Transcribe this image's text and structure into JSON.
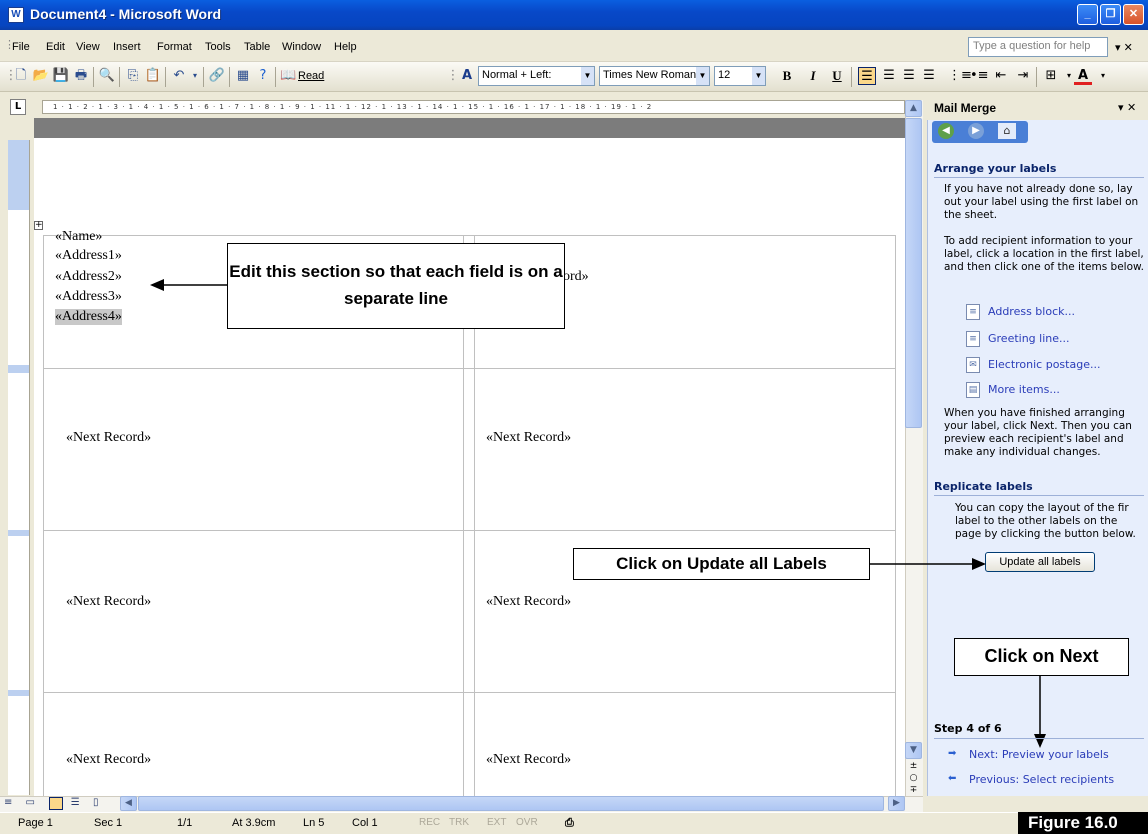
{
  "window": {
    "title": "Document4 - Microsoft Word"
  },
  "menu": {
    "items": [
      "File",
      "Edit",
      "View",
      "Insert",
      "Format",
      "Tools",
      "Table",
      "Window",
      "Help"
    ],
    "help_placeholder": "Type a question for help"
  },
  "toolbar": {
    "read_label": "Read",
    "style": "Normal + Left:",
    "font": "Times New Roman",
    "size": "12",
    "bold": "B",
    "italic": "I",
    "underline": "U"
  },
  "ruler": {
    "ticks": "1 · 1 · 2 · 1 · 3 · 1 · 4 · 1 · 5 · 1 · 6 · 1 · 7 · 1 · 8 · 1 · 9 ·      1 · 11 · 1 · 12 · 1 · 13 · 1 · 14 · 1 · 15 · 1 · 16 · 1 · 17 · 1 · 18 · 1 · 19 · 1 · 2"
  },
  "document": {
    "first_label_fields": [
      "«Name»",
      "«Address1»",
      "«Address2»",
      "«Address3»",
      "«Address4»"
    ],
    "partial_text": "ord»",
    "next_record": "«Next Record»"
  },
  "callouts": {
    "edit_section": "Edit this section so that each field is on a separate line",
    "update_labels": "Click on Update all Labels",
    "next": "Click on Next"
  },
  "task_pane": {
    "title": "Mail Merge",
    "section1_heading": "Arrange your labels",
    "para1": "If you have not already done so, lay out your label using the first label on the sheet.",
    "para2": "To add recipient information to your label, click a location in the first label, and then click one of the items below.",
    "links": [
      "Address block...",
      "Greeting line...",
      "Electronic postage...",
      "More items..."
    ],
    "para3": "When you have finished arranging your label, click Next. Then you can preview each recipient's label and make any individual changes.",
    "section2_heading": "Replicate labels",
    "para4": "You can copy the layout of the fir label to the other labels on the page by clicking the button below.",
    "update_button": "Update all labels",
    "step": "Step 4 of 6",
    "next_link": "Next: Preview your labels",
    "prev_link": "Previous: Select recipients"
  },
  "status": {
    "page": "Page 1",
    "sec": "Sec 1",
    "pages": "1/1",
    "at": "At 3.9cm",
    "ln": "Ln 5",
    "col": "Col 1",
    "modes": [
      "REC",
      "TRK",
      "EXT",
      "OVR"
    ]
  },
  "figure_label": "Figure 16.0"
}
